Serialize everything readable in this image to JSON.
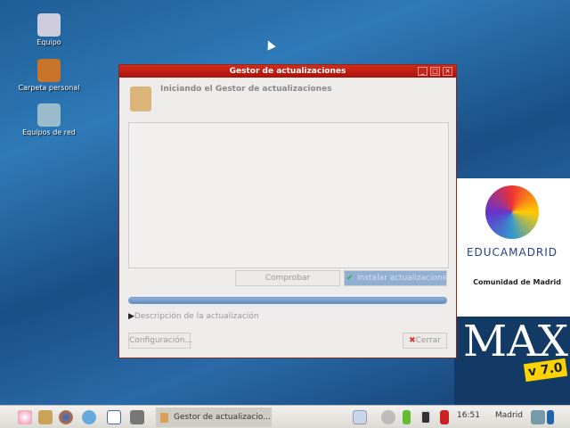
{
  "desktop": {
    "icons": [
      {
        "label": "Equipo"
      },
      {
        "label": "Carpeta personal"
      },
      {
        "label": "Equipos de red"
      }
    ]
  },
  "branding": {
    "educamadrid": "EDUCAMADRID",
    "comunidad": "Comunidad de Madrid",
    "max": "MAX",
    "version": "v 7.0"
  },
  "window": {
    "title": "Gestor de actualizaciones",
    "heading": "Iniciando el Gestor de actualizaciones",
    "check_button": "Comprobar",
    "install_button": "Instalar actualizaciones",
    "expander": "Descripción de la actualización",
    "settings_button": "Configuración...",
    "close_button": "Cerrar",
    "progress": 1.0
  },
  "taskbar": {
    "task_label": "Gestor de actualizacio...",
    "clock": "16:51",
    "location": "Madrid"
  },
  "colors": {
    "titlebar": "#c21d10",
    "progress": "#6b95c6"
  }
}
